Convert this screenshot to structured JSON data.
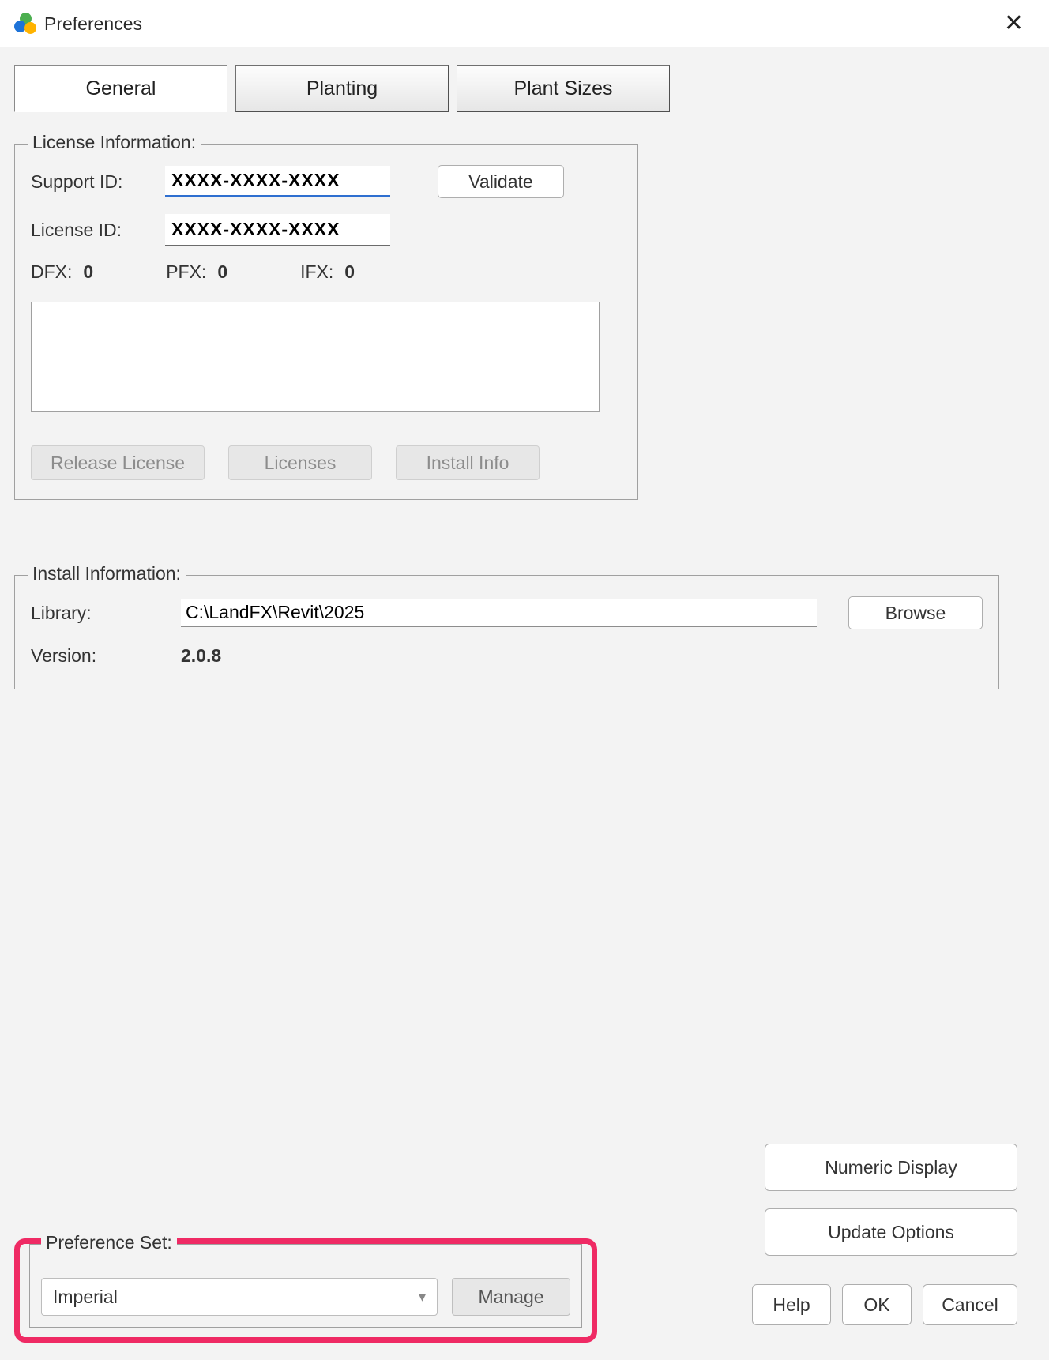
{
  "window": {
    "title": "Preferences"
  },
  "tabs": {
    "general": "General",
    "planting": "Planting",
    "plant_sizes": "Plant Sizes"
  },
  "license": {
    "legend": "License Information:",
    "support_id_label": "Support ID:",
    "support_id_value": "XXXX-XXXX-XXXX",
    "license_id_label": "License ID:",
    "license_id_value": "XXXX-XXXX-XXXX",
    "validate": "Validate",
    "dfx_label": "DFX:",
    "dfx_value": "0",
    "pfx_label": "PFX:",
    "pfx_value": "0",
    "ifx_label": "IFX:",
    "ifx_value": "0",
    "release_license": "Release License",
    "licenses": "Licenses",
    "install_info": "Install Info"
  },
  "install": {
    "legend": "Install Information:",
    "library_label": "Library:",
    "library_value": "C:\\LandFX\\Revit\\2025",
    "browse": "Browse",
    "version_label": "Version:",
    "version_value": "2.0.8"
  },
  "side_buttons": {
    "numeric_display": "Numeric Display",
    "update_options": "Update Options"
  },
  "pref_set": {
    "legend": "Preference Set:",
    "selected": "Imperial",
    "manage": "Manage"
  },
  "footer": {
    "help": "Help",
    "ok": "OK",
    "cancel": "Cancel"
  }
}
